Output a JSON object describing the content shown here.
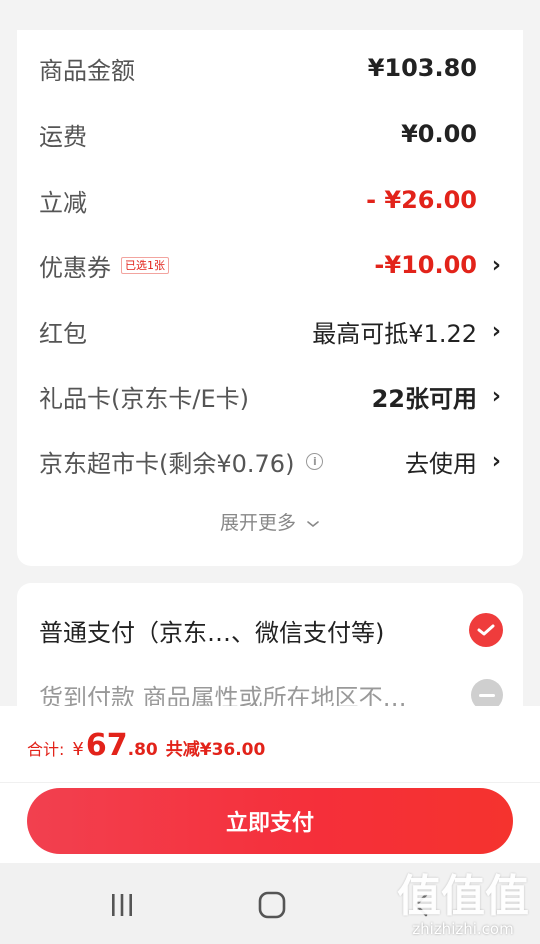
{
  "summary": {
    "rows": [
      {
        "label": "商品金额",
        "value": "¥103.80"
      },
      {
        "label": "运费",
        "value": "¥0.00"
      },
      {
        "label": "立减",
        "value": "- ¥26.00"
      },
      {
        "label": "优惠券",
        "badge": "已选1张",
        "value": "-¥10.00"
      },
      {
        "label": "红包",
        "value": "最高可抵¥1.22"
      },
      {
        "label": "礼品卡(京东卡/E卡)",
        "value": "22张可用"
      },
      {
        "label": "京东超市卡(剩余¥0.76)",
        "value": "去使用"
      }
    ],
    "expand_label": "展开更多"
  },
  "payment": {
    "methods": [
      {
        "label": "普通支付（京东…、微信支付等)",
        "selected": true
      },
      {
        "label": "货到付款   商品属性或所在地区不…",
        "selected": false
      }
    ]
  },
  "footer": {
    "total_label": "合计:",
    "currency": "¥",
    "total_integer": "67",
    "total_decimal": ".80",
    "discount_text": "共减¥36.00",
    "pay_button": "立即支付"
  },
  "watermark": {
    "chars": "值值值",
    "url": "zhizhizhi.com"
  },
  "colors": {
    "accent_red": "#e2231a",
    "button_red": "#f53a3f"
  },
  "icons": [
    "info-icon",
    "chevron-right-icon",
    "chevron-down-icon",
    "check-icon",
    "minus-icon",
    "recent-apps-icon",
    "home-icon",
    "back-icon"
  ]
}
